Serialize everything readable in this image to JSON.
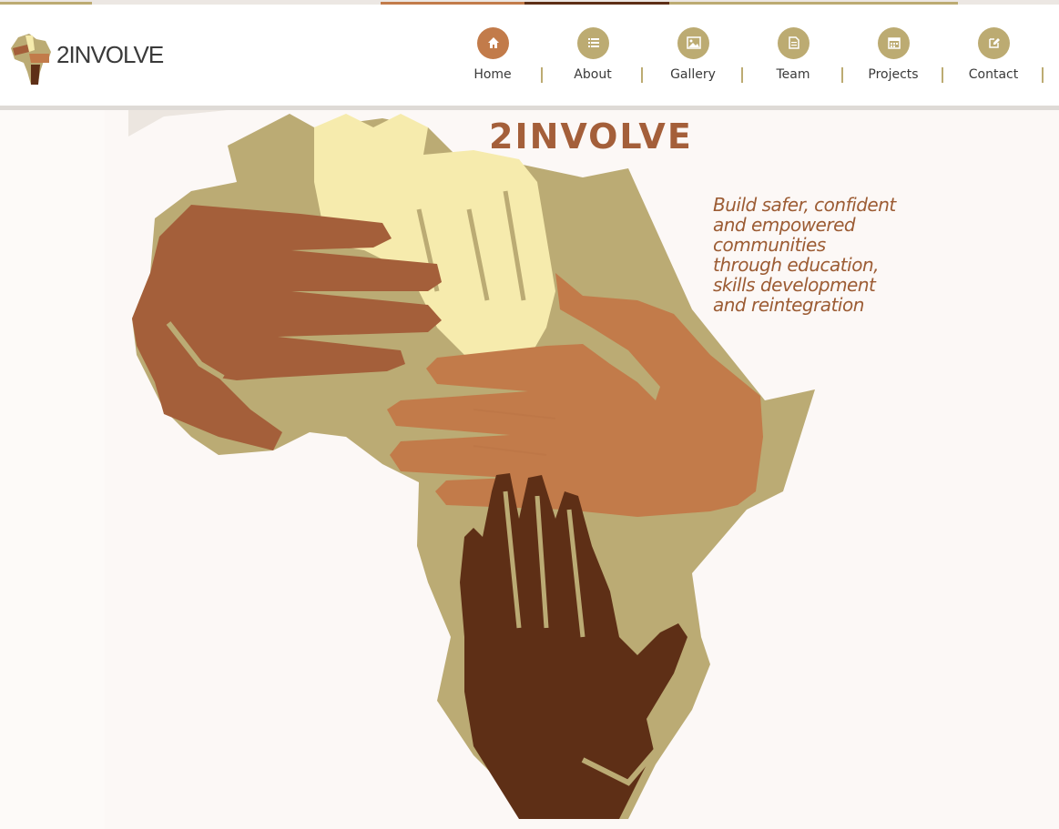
{
  "brand": {
    "logo_text": "2INVOLVE",
    "logo_icon": "africa-hands-icon"
  },
  "nav": {
    "items": [
      {
        "label": "Home",
        "icon": "home-icon",
        "active": true
      },
      {
        "label": "About",
        "icon": "list-icon",
        "active": false
      },
      {
        "label": "Gallery",
        "icon": "image-icon",
        "active": false
      },
      {
        "label": "Team",
        "icon": "document-icon",
        "active": false
      },
      {
        "label": "Projects",
        "icon": "calendar-icon",
        "active": false
      },
      {
        "label": "Contact",
        "icon": "edit-icon",
        "active": false
      }
    ]
  },
  "hero": {
    "title": "2INVOLVE",
    "tagline_lines": [
      "Build safer, confident",
      "and empowered",
      "communities",
      "through education,",
      "skills development",
      "and reintegration"
    ]
  },
  "colors": {
    "accent_brown": "#a45f3a",
    "accent_orange": "#c27b4a",
    "olive": "#bcab72",
    "dark_brown": "#5e2f16",
    "cream_hand": "#f6ebad",
    "map_tan": "#bbab74",
    "background": "#fcf8f6"
  }
}
